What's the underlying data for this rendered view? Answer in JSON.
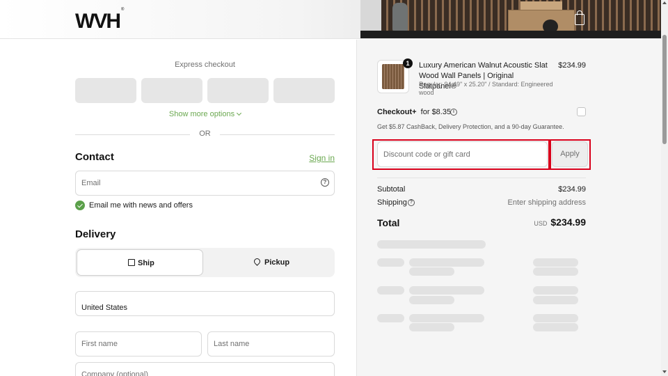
{
  "header": {
    "logo_text": "WVH",
    "logo_mark": "®",
    "cart_icon": "shopping-bag-icon"
  },
  "express": {
    "label": "Express checkout",
    "buttons": [
      "",
      "",
      "",
      ""
    ],
    "show_more": "Show more options",
    "or_text": "OR"
  },
  "contact": {
    "title": "Contact",
    "sign_in": "Sign in",
    "email_placeholder": "Email",
    "news_label": "Email me with news and offers",
    "news_checked": true
  },
  "delivery": {
    "title": "Delivery",
    "options": [
      {
        "label": "Ship",
        "icon": "box-icon",
        "selected": true
      },
      {
        "label": "Pickup",
        "icon": "location-pin-icon",
        "selected": false
      }
    ],
    "country": "United States",
    "first_name_placeholder": "First name",
    "last_name_placeholder": "Last name",
    "company_placeholder": "Company (optional)"
  },
  "order": {
    "item": {
      "quantity": "1",
      "name": "Luxury American Walnut Acoustic Slat Wood Wall Panels | Original Slatpanel®",
      "variant": "Regular: 94.49\" x 25.20\" / Standard: Engineered wood",
      "price": "$234.99"
    },
    "checkout_plus": {
      "title": "Checkout+",
      "price_text": "for $8.35",
      "description": "Get $5.87 CashBack, Delivery Protection, and a 90-day Guarantee.",
      "checked": false
    },
    "discount": {
      "placeholder": "Discount code or gift card",
      "apply_label": "Apply"
    },
    "summary": {
      "subtotal_label": "Subtotal",
      "subtotal_value": "$234.99",
      "shipping_label": "Shipping",
      "shipping_value": "Enter shipping address",
      "total_label": "Total",
      "total_currency": "USD",
      "total_value": "$234.99"
    }
  },
  "colors": {
    "accent": "#6aa84f",
    "check": "#5ba04a",
    "highlight": "#d9001b"
  }
}
